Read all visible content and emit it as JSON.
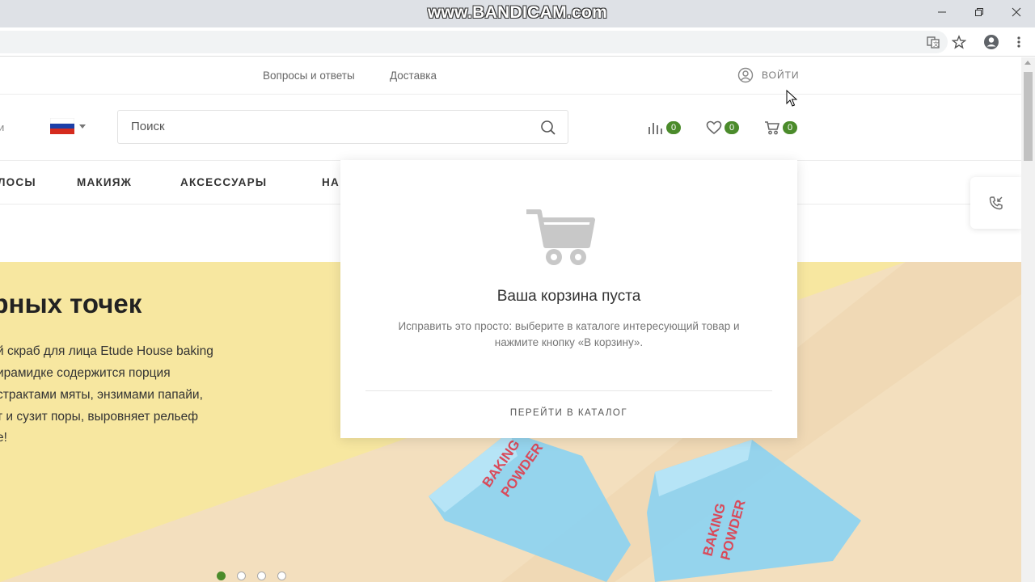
{
  "browser": {
    "watermark": "www.BANDICAM.com",
    "window_controls": [
      "minimize-icon",
      "restore-icon",
      "close-icon"
    ],
    "toolbar_icons": [
      "translate-icon",
      "bookmark-star-icon",
      "profile-icon",
      "menu-icon"
    ]
  },
  "topbar": {
    "links": [
      "Вопросы и ответы",
      "Доставка"
    ],
    "login_label": "ВОЙТИ"
  },
  "header": {
    "search_placeholder": "Поиск",
    "compare_count": "0",
    "wishlist_count": "0",
    "cart_count": "0",
    "left_cut_text": "и"
  },
  "nav": {
    "items": [
      "ЛОСЫ",
      "МАКИЯЖ",
      "АКСЕССУАРЫ",
      "НА"
    ]
  },
  "hero": {
    "title": "ёрных точек",
    "lines": [
      "й скраб для лица Etude House baking",
      "ирамидке содержится порция",
      "страктами мяты, энзимами папайи,",
      "т и сузит поры, выровняет рельеф",
      "е!"
    ],
    "slides_total": 4,
    "active_slide": 1
  },
  "cart_popup": {
    "title": "Ваша корзина пуста",
    "description": "Исправить это просто: выберите в каталоге интересующий товар и нажмите кнопку «В корзину».",
    "link": "ПЕРЕЙТИ В КАТАЛОГ"
  },
  "colors": {
    "accent_green": "#4b8b2b",
    "hero_yellow": "#f7e7a0",
    "hero_peach": "#f3dfbe",
    "product_blue": "#8fd3ef"
  }
}
